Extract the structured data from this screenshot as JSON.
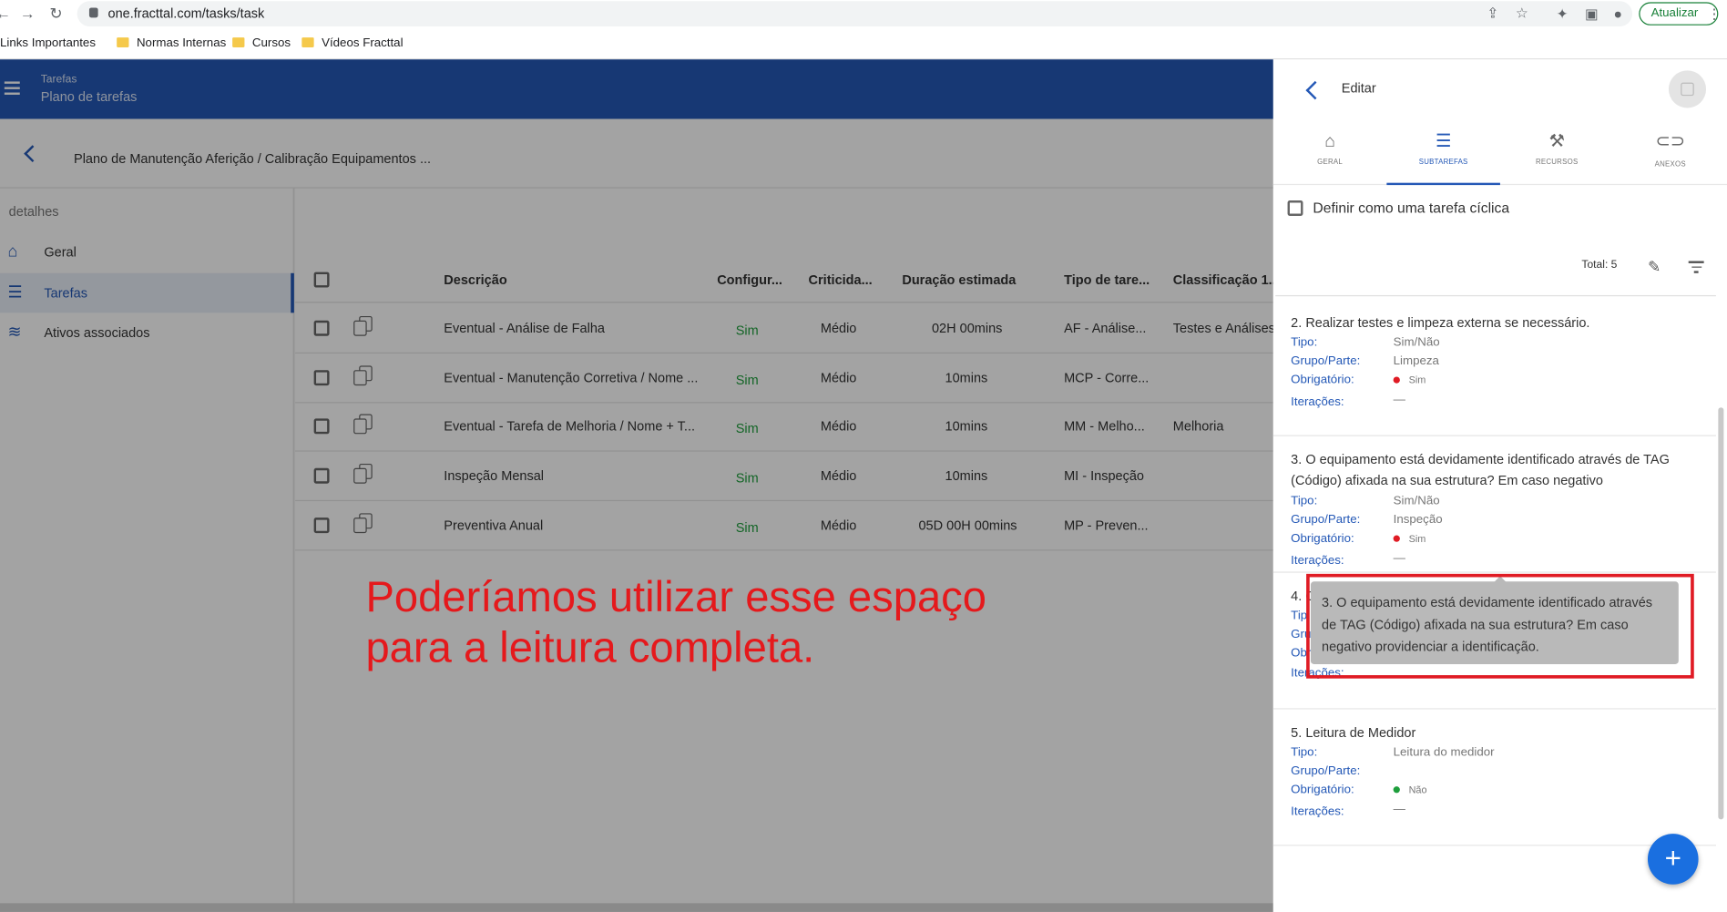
{
  "browser": {
    "url": "one.fracttal.com/tasks/task",
    "update_label": "Atualizar",
    "bookmarks": [
      "Links Importantes",
      "Normas Internas",
      "Cursos",
      "Vídeos Fracttal"
    ]
  },
  "header": {
    "section": "Tarefas",
    "title": "Plano de tarefas"
  },
  "breadcrumb": "Plano de Manutenção Aferição / Calibração Equipamentos ...",
  "leftnav": {
    "section_label": "detalhes",
    "items": [
      {
        "label": "Geral",
        "icon": "home-icon"
      },
      {
        "label": "Tarefas",
        "icon": "checklist-icon",
        "active": true
      },
      {
        "label": "Ativos associados",
        "icon": "layers-icon"
      }
    ]
  },
  "table": {
    "columns": [
      "Descrição",
      "Configur...",
      "Criticida...",
      "Duração estimada",
      "Tipo de tare...",
      "Classificação 1..."
    ],
    "rows": [
      {
        "descricao": "Eventual - Análise de Falha",
        "config": "Sim",
        "criticidade": "Médio",
        "duracao": "02H 00mins",
        "tipo": "AF - Análise...",
        "classificacao": "Testes e Análises"
      },
      {
        "descricao": "Eventual - Manutenção Corretiva / Nome ...",
        "config": "Sim",
        "criticidade": "Médio",
        "duracao": "10mins",
        "tipo": "MCP - Corre...",
        "classificacao": ""
      },
      {
        "descricao": "Eventual - Tarefa de Melhoria / Nome + T...",
        "config": "Sim",
        "criticidade": "Médio",
        "duracao": "10mins",
        "tipo": "MM - Melho...",
        "classificacao": "Melhoria"
      },
      {
        "descricao": "Inspeção Mensal",
        "config": "Sim",
        "criticidade": "Médio",
        "duracao": "10mins",
        "tipo": "MI - Inspeção",
        "classificacao": ""
      },
      {
        "descricao": "Preventiva Anual",
        "config": "Sim",
        "criticidade": "Médio",
        "duracao": "05D 00H 00mins",
        "tipo": "MP - Preven...",
        "classificacao": ""
      }
    ]
  },
  "annotation": {
    "line1": "Poderíamos utilizar esse espaço",
    "line2": "para a leitura completa.",
    "color": "#e5191c"
  },
  "panel": {
    "title": "Editar",
    "tabs": [
      {
        "label": "GERAL",
        "icon": "home-icon"
      },
      {
        "label": "SUBTAREFAS",
        "icon": "checklist-icon",
        "active": true
      },
      {
        "label": "RECURSOS",
        "icon": "wrench-icon"
      },
      {
        "label": "ANEXOS",
        "icon": "paperclip-icon"
      }
    ],
    "cyclic_label": "Definir como uma tarefa cíclica",
    "total_label": "Total: 5",
    "field_labels": {
      "tipo": "Tipo:",
      "grupo": "Grupo/Parte:",
      "obrigatorio": "Obrigatório:",
      "iteracoes": "Iterações:"
    },
    "subtasks": [
      {
        "title": "2. Realizar testes e limpeza externa se necessário.",
        "tipo": "Sim/Não",
        "grupo": "Limpeza",
        "obrigatorio": "Sim",
        "iteracoes": "—"
      },
      {
        "title": "3. O equipamento está devidamente identificado através de TAG (Código) afixada na sua estrutura? Em caso negativo",
        "tipo": "Sim/Não",
        "grupo": "Inspeção",
        "obrigatorio": "Sim",
        "iteracoes": "—"
      },
      {
        "title": "4. O",
        "tipo_short": "Tip",
        "grupo_short": "Gru",
        "obrig_short": "Obr",
        "iteracoes_short": "Iterações:"
      },
      {
        "title": "5. Leitura de Medidor",
        "tipo": "Leitura do medidor",
        "grupo": "",
        "obrigatorio": "Não",
        "iteracoes": "—"
      }
    ],
    "tooltip": "3. O equipamento está devidamente identificado através de TAG (Código) afixada na sua estrutura? Em caso negativo providenciar a identificação.",
    "colors": {
      "required_yes": "#e01b24",
      "required_no": "#1e9e3c",
      "accent": "#2458b6"
    }
  }
}
